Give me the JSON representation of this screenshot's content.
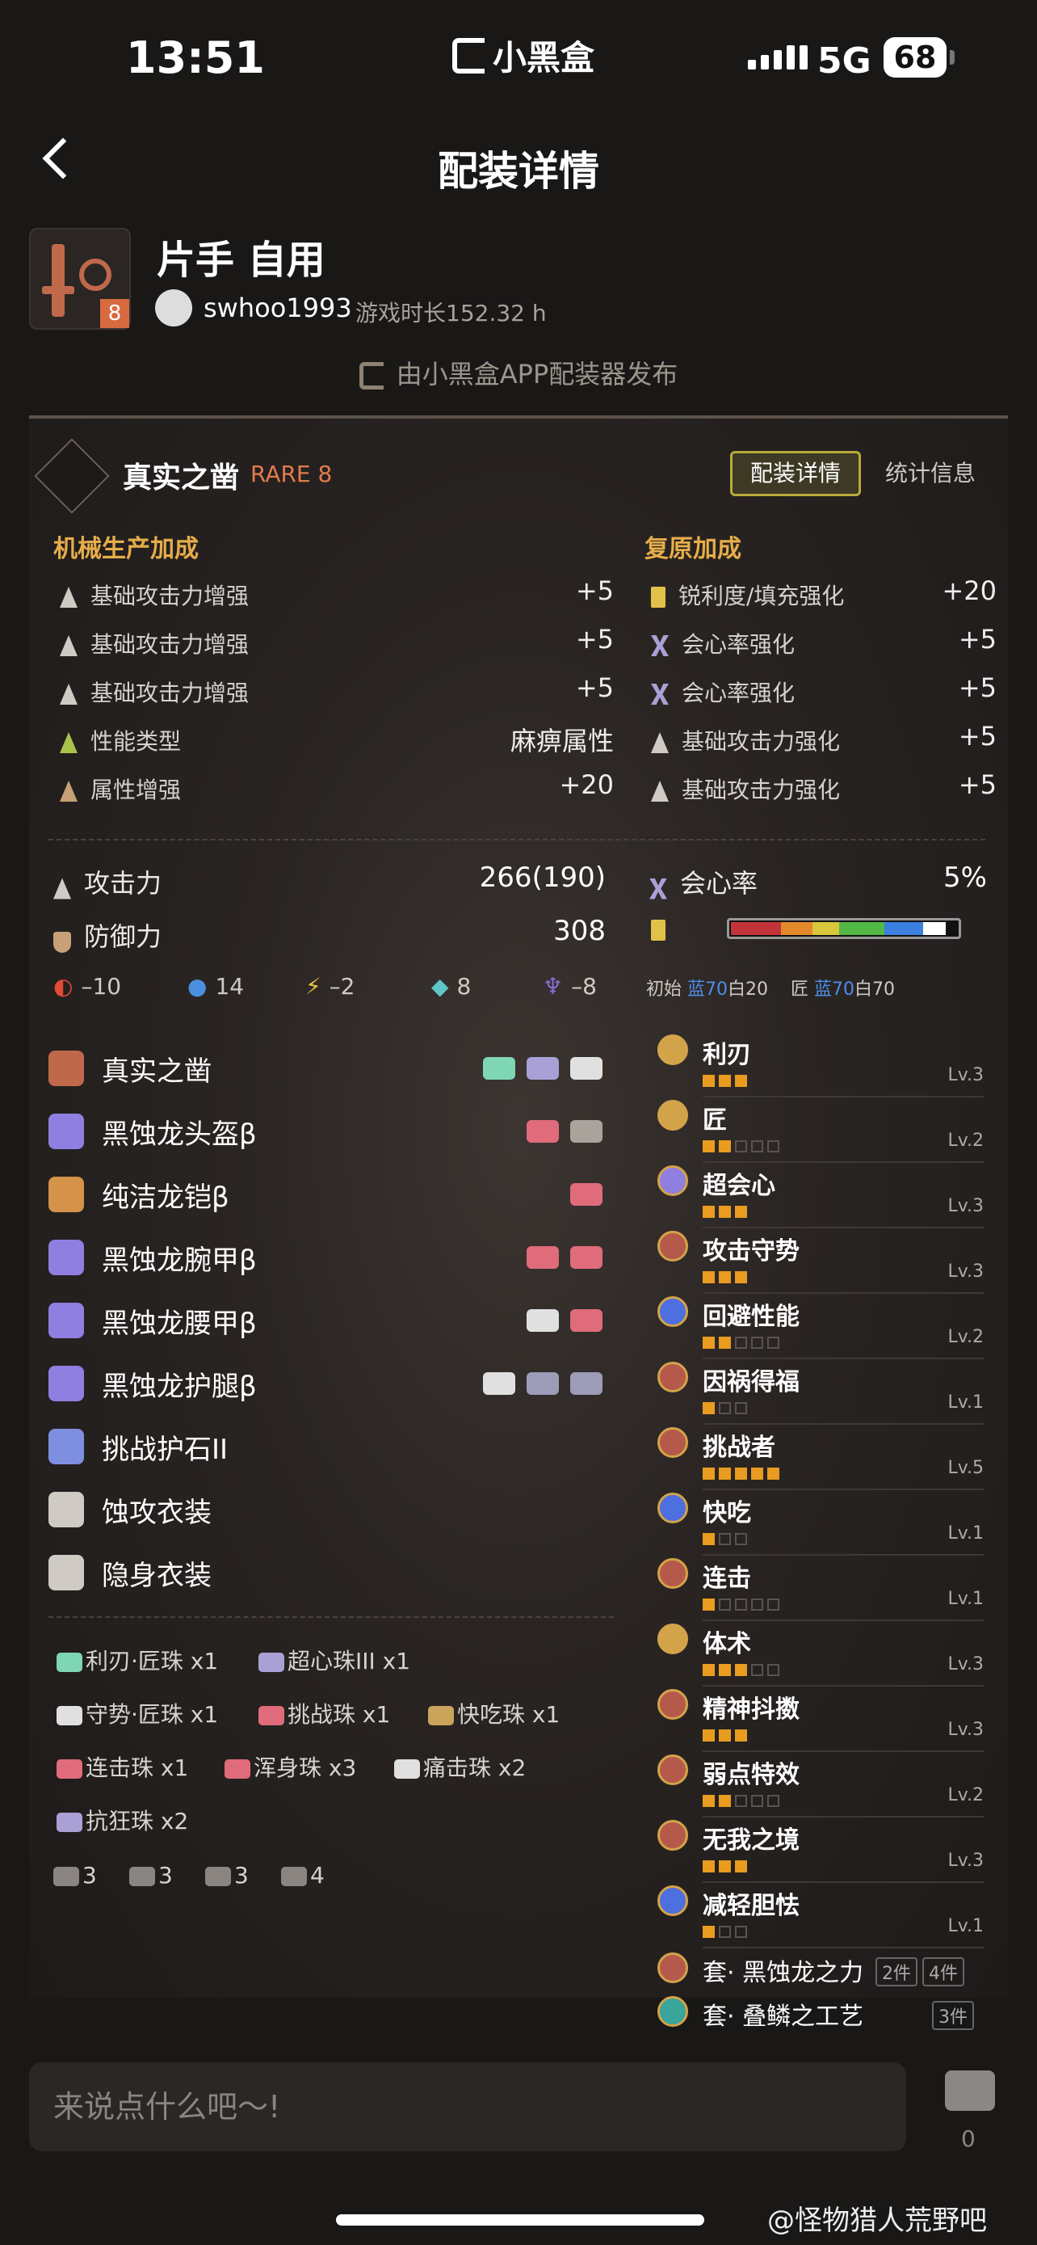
{
  "status": {
    "time": "13:51",
    "app_brand": "小黑盒",
    "network": "5G",
    "battery": "68"
  },
  "nav": {
    "title": "配装详情"
  },
  "build": {
    "title": "片手 自用",
    "weapon_level": "8",
    "username": "swhoo1993",
    "playtime": "游戏时长152.32 h",
    "published_by": "由小黑盒APP配装器发布"
  },
  "weapon": {
    "name": "真实之凿",
    "rarity": "RARE 8"
  },
  "tabs": {
    "active": "配装详情",
    "other": "统计信息"
  },
  "mech": {
    "heading": "机械生产加成",
    "rows": [
      {
        "label": "基础攻击力增强",
        "value": "+5"
      },
      {
        "label": "基础攻击力增强",
        "value": "+5"
      },
      {
        "label": "基础攻击力增强",
        "value": "+5"
      },
      {
        "label": "性能类型",
        "value": "麻痹属性"
      },
      {
        "label": "属性增强",
        "value": "+20"
      }
    ]
  },
  "restore": {
    "heading": "复原加成",
    "rows": [
      {
        "label": "锐利度/填充强化",
        "value": "+20"
      },
      {
        "label": "会心率强化",
        "value": "+5"
      },
      {
        "label": "会心率强化",
        "value": "+5"
      },
      {
        "label": "基础攻击力强化",
        "value": "+5"
      },
      {
        "label": "基础攻击力强化",
        "value": "+5"
      }
    ]
  },
  "stats": {
    "attack_label": "攻击力",
    "attack_value": "266(190)",
    "defense_label": "防御力",
    "defense_value": "308",
    "affinity_label": "会心率",
    "affinity_value": "5%",
    "res": [
      "–10",
      "14",
      "–2",
      "8",
      "–8"
    ],
    "sharp_init_label": "初始",
    "sharp_init_blue": "蓝70",
    "sharp_init_white": "白20",
    "sharp_hm_label": "匠",
    "sharp_hm_blue": "蓝70",
    "sharp_hm_white": "白70"
  },
  "equipment": [
    {
      "name": "真实之凿"
    },
    {
      "name": "黑蚀龙头盔β"
    },
    {
      "name": "纯洁龙铠β"
    },
    {
      "name": "黑蚀龙腕甲β"
    },
    {
      "name": "黑蚀龙腰甲β"
    },
    {
      "name": "黑蚀龙护腿β"
    },
    {
      "name": "挑战护石II"
    },
    {
      "name": "蚀攻衣装"
    },
    {
      "name": "隐身衣装"
    }
  ],
  "decorations": [
    [
      "利刃·匠珠 x1",
      "超心珠III x1"
    ],
    [
      "守势·匠珠 x1",
      "挑战珠 x1",
      "快吃珠 x1"
    ],
    [
      "连击珠 x1",
      "浑身珠 x3",
      "痛击珠 x2"
    ],
    [
      "抗狂珠 x2"
    ]
  ],
  "slot_summary": [
    "3",
    "3",
    "3",
    "4"
  ],
  "skills": [
    {
      "name": "利刃",
      "level": "Lv.3",
      "filled": 3,
      "total": 3
    },
    {
      "name": "匠",
      "level": "Lv.2",
      "filled": 2,
      "total": 5
    },
    {
      "name": "超会心",
      "level": "Lv.3",
      "filled": 3,
      "total": 3
    },
    {
      "name": "攻击守势",
      "level": "Lv.3",
      "filled": 3,
      "total": 3
    },
    {
      "name": "回避性能",
      "level": "Lv.2",
      "filled": 2,
      "total": 5
    },
    {
      "name": "因祸得福",
      "level": "Lv.1",
      "filled": 1,
      "total": 3
    },
    {
      "name": "挑战者",
      "level": "Lv.5",
      "filled": 5,
      "total": 5
    },
    {
      "name": "快吃",
      "level": "Lv.1",
      "filled": 1,
      "total": 3
    },
    {
      "name": "连击",
      "level": "Lv.1",
      "filled": 1,
      "total": 5
    },
    {
      "name": "体术",
      "level": "Lv.3",
      "filled": 3,
      "total": 5
    },
    {
      "name": "精神抖擞",
      "level": "Lv.3",
      "filled": 3,
      "total": 3
    },
    {
      "name": "弱点特效",
      "level": "Lv.2",
      "filled": 2,
      "total": 5
    },
    {
      "name": "无我之境",
      "level": "Lv.3",
      "filled": 3,
      "total": 3
    },
    {
      "name": "减轻胆怯",
      "level": "Lv.1",
      "filled": 1,
      "total": 3
    }
  ],
  "sets": [
    {
      "name": "套· 黑蚀龙之力",
      "counts": [
        "2件",
        "4件"
      ]
    },
    {
      "name": "套· 叠鳞之工艺",
      "counts": [
        "3件"
      ]
    }
  ],
  "comment": {
    "placeholder": "来说点什么吧～!",
    "count": "0"
  },
  "watermark": "@怪物猎人荒野吧"
}
